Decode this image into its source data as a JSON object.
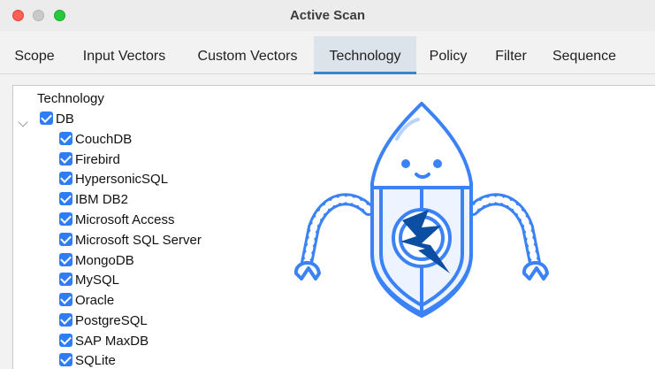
{
  "window": {
    "title": "Active Scan"
  },
  "tabs": [
    {
      "label": "Scope",
      "active": false
    },
    {
      "label": "Input Vectors",
      "active": false
    },
    {
      "label": "Custom Vectors",
      "active": false
    },
    {
      "label": "Technology",
      "active": true
    },
    {
      "label": "Policy",
      "active": false
    },
    {
      "label": "Filter",
      "active": false
    },
    {
      "label": "Sequence",
      "active": false
    }
  ],
  "tree": {
    "root_label": "Technology",
    "db": {
      "label": "DB",
      "checked": true,
      "expanded": true,
      "items": [
        {
          "label": "CouchDB",
          "checked": true
        },
        {
          "label": "Firebird",
          "checked": true
        },
        {
          "label": "HypersonicSQL",
          "checked": true
        },
        {
          "label": "IBM DB2",
          "checked": true
        },
        {
          "label": "Microsoft Access",
          "checked": true
        },
        {
          "label": "Microsoft SQL Server",
          "checked": true
        },
        {
          "label": "MongoDB",
          "checked": true
        },
        {
          "label": "MySQL",
          "checked": true
        },
        {
          "label": "Oracle",
          "checked": true
        },
        {
          "label": "PostgreSQL",
          "checked": true
        },
        {
          "label": "SAP MaxDB",
          "checked": true
        },
        {
          "label": "SQLite",
          "checked": true
        }
      ]
    }
  },
  "colors": {
    "accent": "#3a86c8",
    "checkbox": "#2f7df6",
    "mascot_blue": "#3b82f6",
    "mascot_dark": "#0b4ea2"
  },
  "icons": {
    "mascot": "zap-robot-mascot",
    "chevron": "chevron-down-icon"
  }
}
